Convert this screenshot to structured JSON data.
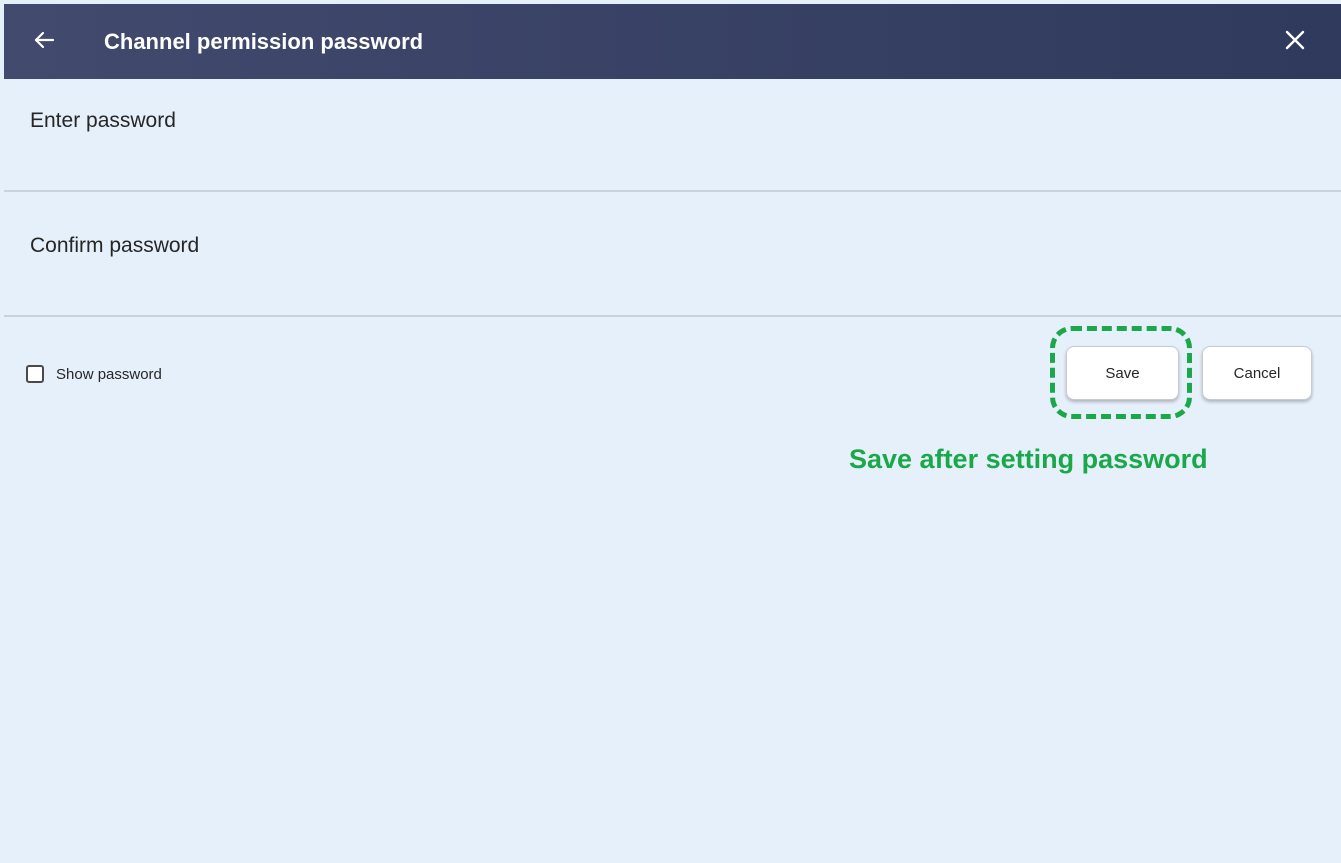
{
  "header": {
    "title": "Channel permission password",
    "back_icon": "arrow-left-icon",
    "close_icon": "close-icon",
    "background_color": "#3a4466"
  },
  "fields": {
    "enter_password": {
      "label": "Enter password",
      "value": ""
    },
    "confirm_password": {
      "label": "Confirm password",
      "value": ""
    }
  },
  "show_password": {
    "label": "Show password",
    "checked": false
  },
  "buttons": {
    "save_label": "Save",
    "cancel_label": "Cancel"
  },
  "annotation": {
    "text": "Save after setting password",
    "color": "#1aa84a"
  },
  "colors": {
    "background": "#e6f0fa",
    "divider": "#c9d3de"
  }
}
